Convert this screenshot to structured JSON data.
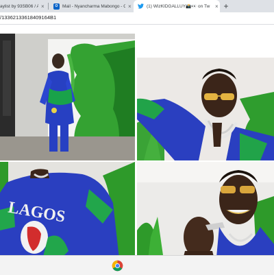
{
  "browser": {
    "tabs": [
      {
        "title": "aylist by 93SB06 / A",
        "icon": "music-icon",
        "active": false
      },
      {
        "title": "Mail - Nyancharma Mabongo - O",
        "icon": "outlook-icon",
        "active": false
      },
      {
        "title": "(1) WizKIDGALLUY📸👀 on Tw",
        "icon": "twitter-icon",
        "active": true
      }
    ],
    "close_glyph": "×",
    "new_tab_glyph": "+",
    "outlook_letter": "O",
    "url": "/13362133618409164B1"
  },
  "video_frames": [
    {
      "name": "frame-singer-blue-outfit-green-backdrop"
    },
    {
      "name": "frame-singer-sunglasses-chains"
    },
    {
      "name": "frame-lagos-shirt-back"
    },
    {
      "name": "frame-singer-grills-smile"
    }
  ],
  "shirt_text": "LAGOS",
  "taskbar": {
    "pinned": [
      "chrome-icon"
    ]
  },
  "colors": {
    "tabstrip": "#dee1e6",
    "green_paint": "#2e9a2a",
    "shirt_blue": "#2a3fc0",
    "twitter": "#1d9bf0"
  }
}
